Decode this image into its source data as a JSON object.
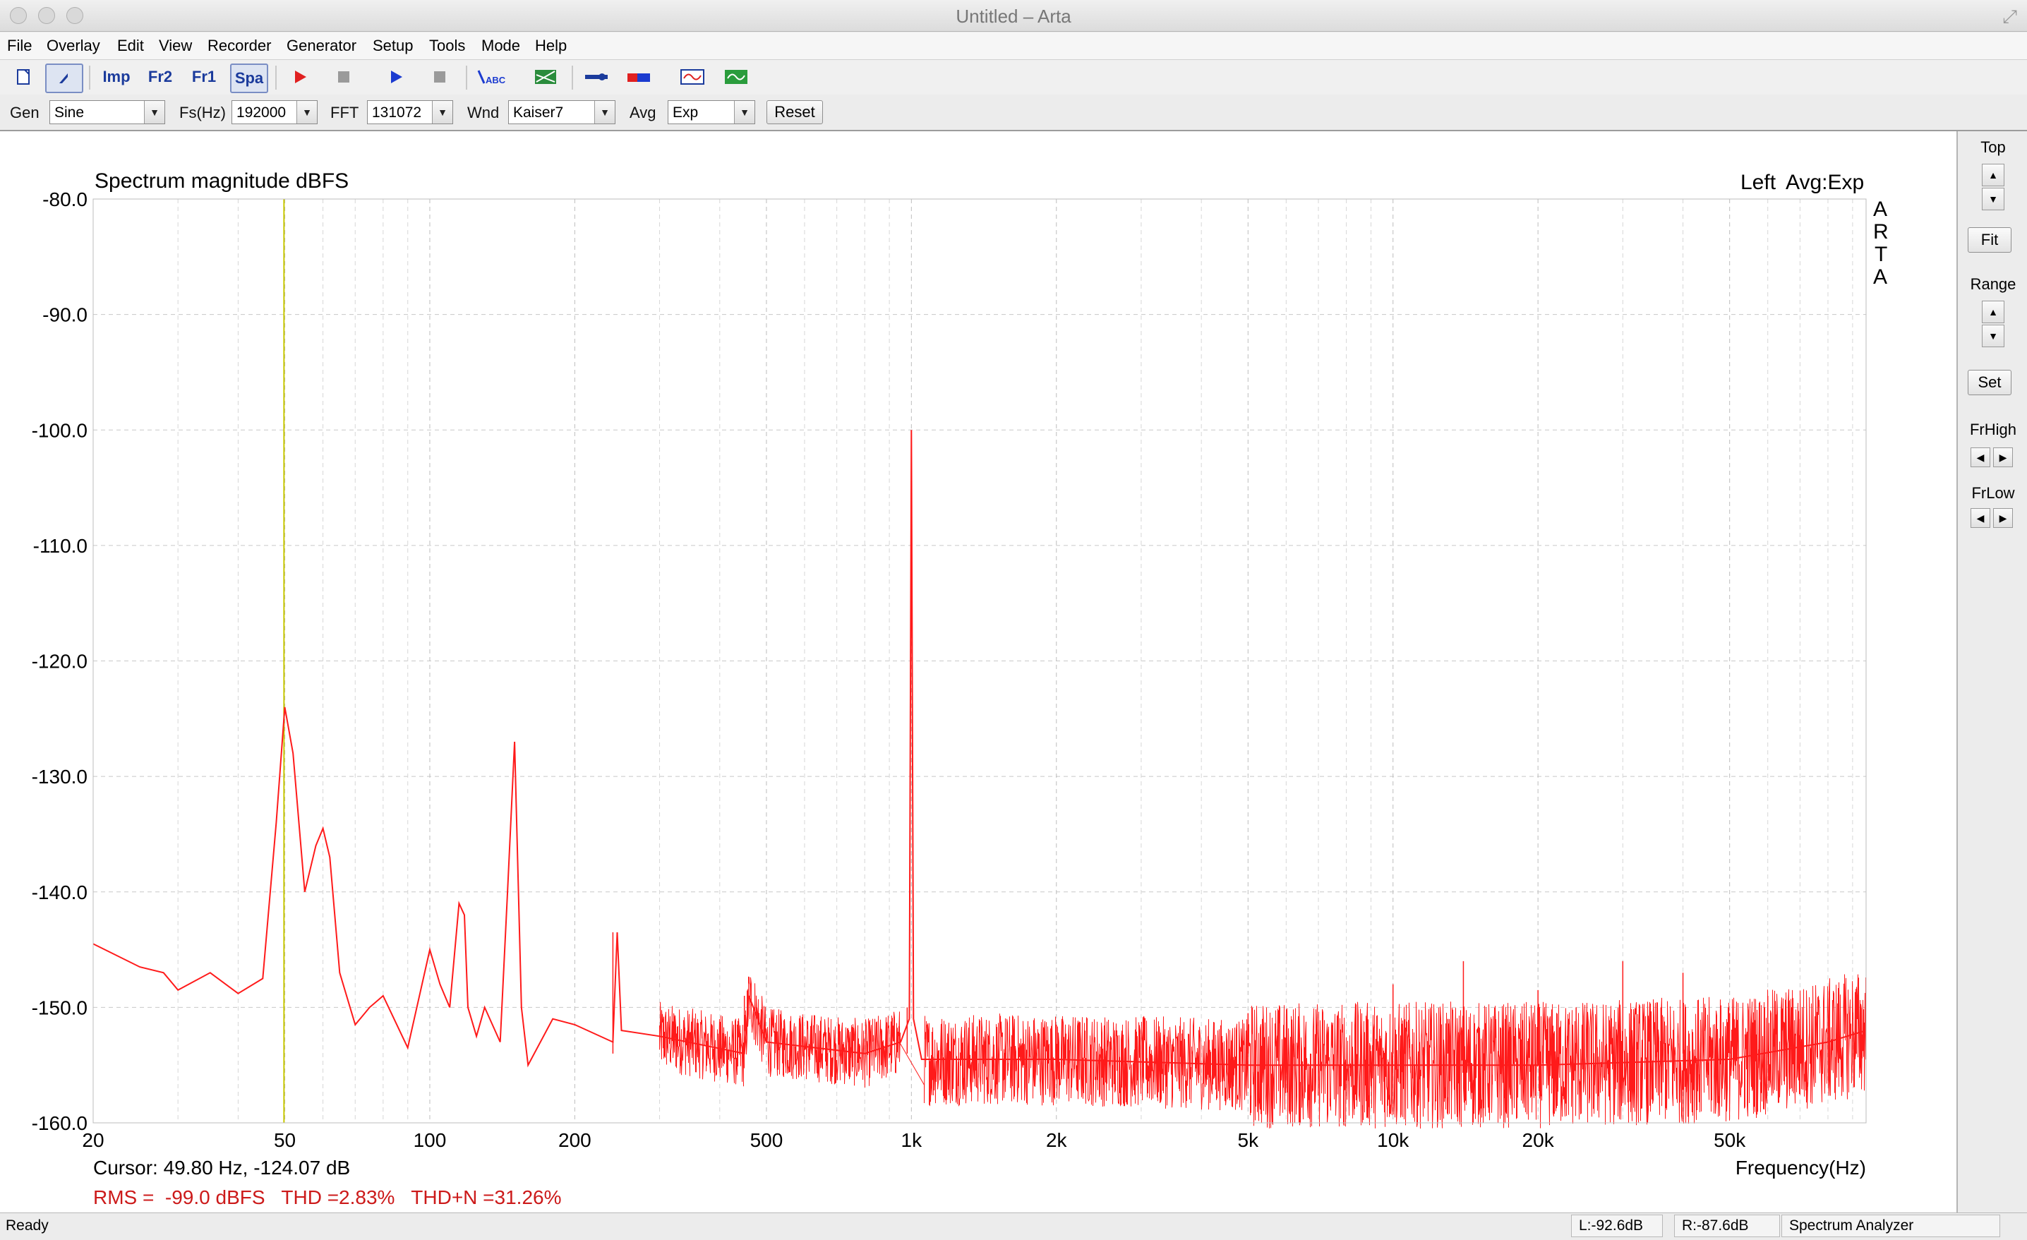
{
  "window": {
    "title": "Untitled – Arta"
  },
  "menu": [
    "File",
    "Overlay",
    "Edit",
    "View",
    "Recorder",
    "Generator",
    "Setup",
    "Tools",
    "Mode",
    "Help"
  ],
  "toolbar": {
    "buttons": [
      {
        "id": "new",
        "icon": "new-document-icon",
        "label": ""
      },
      {
        "id": "cursor",
        "icon": "cursor-arrow-icon",
        "label": ""
      },
      {
        "id": "imp",
        "icon": "impulse-mode-icon",
        "label": "Imp"
      },
      {
        "id": "fr2",
        "icon": "dual-channel-fr-icon",
        "label": "Fr2"
      },
      {
        "id": "fr1",
        "icon": "single-channel-fr-icon",
        "label": "Fr1"
      },
      {
        "id": "spa",
        "icon": "spectrum-analyzer-icon",
        "label": "Spa"
      },
      {
        "id": "record",
        "icon": "record-play-icon",
        "label": ""
      },
      {
        "id": "stop-record",
        "icon": "stop-icon",
        "label": ""
      },
      {
        "id": "play",
        "icon": "play-icon",
        "label": ""
      },
      {
        "id": "stop-play",
        "icon": "stop-icon",
        "label": ""
      },
      {
        "id": "abc",
        "icon": "overlay-abc-icon",
        "label": "ABC"
      },
      {
        "id": "scale",
        "icon": "scale-icon",
        "label": ""
      },
      {
        "id": "tool1",
        "icon": "probe-icon",
        "label": ""
      },
      {
        "id": "tool2",
        "icon": "level-meter-icon",
        "label": ""
      },
      {
        "id": "tool3",
        "icon": "scope-icon",
        "label": ""
      },
      {
        "id": "tool4",
        "icon": "generator-wave-icon",
        "label": ""
      }
    ]
  },
  "params": {
    "gen_label": "Gen",
    "gen_value": "Sine",
    "fs_label": "Fs(Hz)",
    "fs_value": "192000",
    "fft_label": "FFT",
    "fft_value": "131072",
    "wnd_label": "Wnd",
    "wnd_value": "Kaiser7",
    "avg_label": "Avg",
    "avg_value": "Exp",
    "reset_label": "Reset"
  },
  "plot": {
    "title": "Spectrum magnitude dBFS",
    "channel": "Left",
    "avg_info": "Avg:Exp",
    "watermark": "ARTA",
    "xlabel": "Frequency(Hz)",
    "cursor_text": "Cursor: 49.80 Hz, -124.07 dB",
    "stats_text": "RMS =  -99.0 dBFS   THD =2.83%   THD+N =31.26%",
    "cursor_hz": 49.8,
    "color_trace": "#ff1a1a",
    "color_cursor": "#c8c800"
  },
  "side": {
    "top_label": "Top",
    "fit_label": "Fit",
    "range_label": "Range",
    "set_label": "Set",
    "frhigh_label": "FrHigh",
    "frlow_label": "FrLow"
  },
  "status": {
    "ready": "Ready",
    "left_level": "L:-92.6dB",
    "right_level": "R:-87.6dB",
    "mode": "Spectrum Analyzer"
  },
  "chart_data": {
    "type": "line",
    "title": "Spectrum magnitude dBFS",
    "xlabel": "Frequency(Hz)",
    "ylabel": "",
    "xscale": "log",
    "xlim": [
      20,
      96000
    ],
    "ylim": [
      -160,
      -80
    ],
    "grid": true,
    "y_ticks": [
      "-80.0",
      "-90.0",
      "-100.0",
      "-110.0",
      "-120.0",
      "-130.0",
      "-140.0",
      "-150.0",
      "-160.0"
    ],
    "y_tick_values": [
      -80,
      -90,
      -100,
      -110,
      -120,
      -130,
      -140,
      -150,
      -160
    ],
    "x_ticks": [
      "20",
      "50",
      "100",
      "200",
      "500",
      "1k",
      "2k",
      "5k",
      "10k",
      "20k",
      "50k"
    ],
    "x_tick_values": [
      20,
      50,
      100,
      200,
      500,
      1000,
      2000,
      5000,
      10000,
      20000,
      50000
    ],
    "series": [
      {
        "values_desc": "envelope",
        "x": [
          20,
          25,
          28,
          30,
          35,
          40,
          45,
          48,
          50,
          52,
          55,
          58,
          60,
          62,
          65,
          70,
          75,
          80,
          90,
          100,
          105,
          110,
          115,
          118,
          120,
          125,
          130,
          140,
          145,
          150,
          155,
          160,
          180,
          200,
          240,
          245,
          250,
          300,
          450,
          460,
          500,
          800,
          950,
          990,
          1000,
          1010,
          1050,
          2000,
          5000,
          10000,
          20000,
          50000,
          80000,
          96000
        ],
        "y": [
          -144.5,
          -146.5,
          -147,
          -148.5,
          -147,
          -148.8,
          -147.5,
          -134,
          -124,
          -128,
          -140,
          -136,
          -134.5,
          -137,
          -147,
          -151.5,
          -150,
          -149,
          -153.5,
          -145,
          -148,
          -150,
          -141,
          -142,
          -150,
          -152.5,
          -150,
          -153,
          -140,
          -127,
          -150,
          -155,
          -151,
          -151.5,
          -153,
          -143.5,
          -152,
          -152.5,
          -154,
          -149,
          -153,
          -154,
          -153,
          -151,
          -100,
          -151,
          -154.5,
          -154.5,
          -155,
          -155,
          -155,
          -154.5,
          -153,
          -152
        ]
      }
    ],
    "spurs": [
      {
        "x": 240,
        "y": -143.5
      },
      {
        "x": 450,
        "y": -149
      },
      {
        "x": 980,
        "y": -150
      },
      {
        "x": 2000,
        "y": -151.5
      },
      {
        "x": 5000,
        "y": -150.5
      },
      {
        "x": 10000,
        "y": -148
      },
      {
        "x": 13000,
        "y": -151
      },
      {
        "x": 14000,
        "y": -146
      },
      {
        "x": 16000,
        "y": -151
      },
      {
        "x": 20000,
        "y": -148.5
      },
      {
        "x": 24000,
        "y": -150
      },
      {
        "x": 30000,
        "y": -146
      },
      {
        "x": 36000,
        "y": -150
      },
      {
        "x": 40000,
        "y": -147
      },
      {
        "x": 50000,
        "y": -150.5
      },
      {
        "x": 60000,
        "y": -149
      },
      {
        "x": 70000,
        "y": -151
      }
    ]
  }
}
